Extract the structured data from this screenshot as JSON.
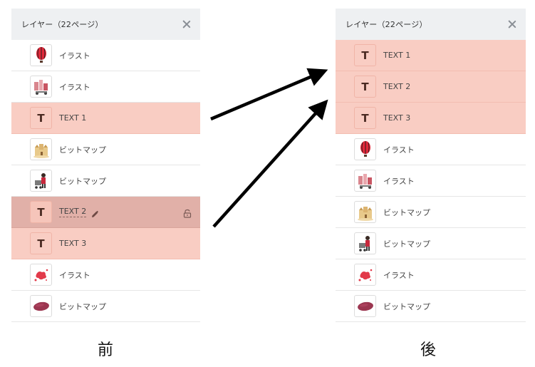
{
  "before": {
    "header_title": "レイヤー（22ページ）",
    "caption": "前",
    "layers": [
      {
        "label": "イラスト",
        "thumb": "balloon",
        "type": "image"
      },
      {
        "label": "イラスト",
        "thumb": "city",
        "type": "image"
      },
      {
        "label": "TEXT 1",
        "thumb": "T",
        "type": "text"
      },
      {
        "label": "ビットマップ",
        "thumb": "castle",
        "type": "image"
      },
      {
        "label": "ビットマップ",
        "thumb": "shopper",
        "type": "image"
      },
      {
        "label": "TEXT 2",
        "thumb": "T",
        "type": "text-active"
      },
      {
        "label": "TEXT 3",
        "thumb": "T",
        "type": "text"
      },
      {
        "label": "イラスト",
        "thumb": "splash",
        "type": "image"
      },
      {
        "label": "ビットマップ",
        "thumb": "potato",
        "type": "image"
      }
    ]
  },
  "after": {
    "header_title": "レイヤー（22ページ）",
    "caption": "後",
    "layers": [
      {
        "label": "TEXT 1",
        "thumb": "T",
        "type": "text"
      },
      {
        "label": "TEXT 2",
        "thumb": "T",
        "type": "text"
      },
      {
        "label": "TEXT 3",
        "thumb": "T",
        "type": "text"
      },
      {
        "label": "イラスト",
        "thumb": "balloon",
        "type": "image"
      },
      {
        "label": "イラスト",
        "thumb": "city",
        "type": "image"
      },
      {
        "label": "ビットマップ",
        "thumb": "castle",
        "type": "image"
      },
      {
        "label": "ビットマップ",
        "thumb": "shopper",
        "type": "image"
      },
      {
        "label": "イラスト",
        "thumb": "splash",
        "type": "image"
      },
      {
        "label": "ビットマップ",
        "thumb": "potato",
        "type": "image"
      }
    ]
  },
  "text_thumb_glyph": "T",
  "colors": {
    "text_row": "#f9cdc3",
    "active_row": "#e1b0a8",
    "header": "#eef0f2",
    "arrow": "#000000"
  },
  "icons": [
    "close-icon",
    "pencil-icon",
    "lock-icon"
  ]
}
